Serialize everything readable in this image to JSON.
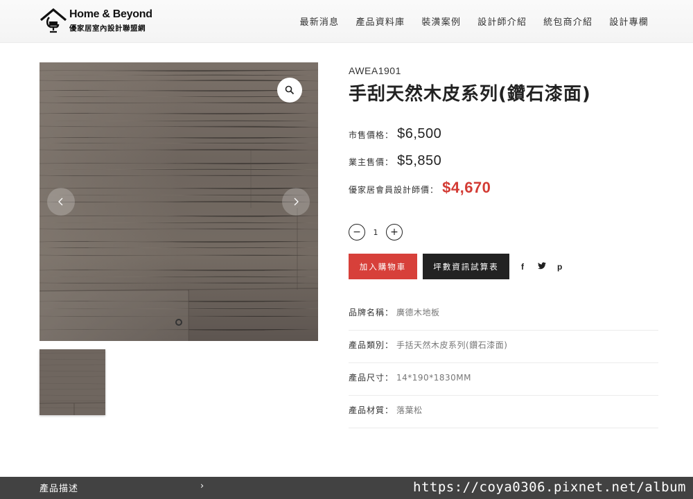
{
  "brand": {
    "title": "Home & Beyond",
    "subtitle": "優家居室內設計聯盟網"
  },
  "nav": [
    "最新消息",
    "產品資料庫",
    "裝潢案例",
    "設計師介紹",
    "統包商介紹",
    "設計專欄"
  ],
  "product": {
    "sku": "AWEA1901",
    "title": "手刮天然木皮系列(鑽石漆面)",
    "prices": {
      "market_label": "市售價格：",
      "market_value": "$6,500",
      "owner_label": "業主售價：",
      "owner_value": "$5,850",
      "member_label": "優家居會員設計師價：",
      "member_value": "$4,670"
    },
    "quantity": "1",
    "qty_minus": "−",
    "qty_plus": "+",
    "add_to_cart": "加入購物車",
    "calculator": "坪數資訊試算表",
    "share": {
      "facebook": "f",
      "twitter": "t",
      "pinterest": "p"
    },
    "attributes": [
      {
        "key": "品牌名稱：",
        "value": "廣德木地板"
      },
      {
        "key": "產品類別：",
        "value": "手括天然木皮系列(鑽石漆面)"
      },
      {
        "key": "產品尺寸：",
        "value": "14*190*1830MM"
      },
      {
        "key": "產品材質：",
        "value": "落葉松"
      }
    ]
  },
  "description_tab": "產品描述",
  "watermark": "https://coya0306.pixnet.net/album",
  "colors": {
    "accent_red": "#d7403a",
    "member_price_red": "#d33b34",
    "dark_button": "#222222"
  }
}
